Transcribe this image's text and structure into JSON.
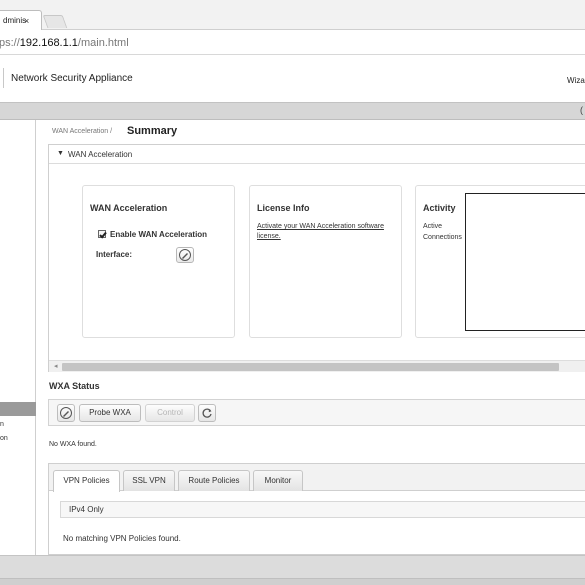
{
  "browser": {
    "tab_title": "dminis",
    "tab_close": "×",
    "url_scheme": "ps://",
    "url_host": "192.168.1.1",
    "url_path": "/main.html"
  },
  "header": {
    "app_title": "Network Security Appliance",
    "wizard_label": "Wiza",
    "right_edge_glyph": "("
  },
  "sidebar": {
    "items": [
      "n",
      "on"
    ]
  },
  "breadcrumb": "WAN Acceleration /",
  "page_title": "Summary",
  "wan_section": {
    "header": "WAN Acceleration",
    "cards": {
      "wan": {
        "title": "WAN Acceleration",
        "enable_label": "Enable WAN Acceleration",
        "enable_checked": true,
        "interface_label": "Interface:"
      },
      "license": {
        "title": "License Info",
        "link": "Activate your WAN Acceleration software license."
      },
      "activity": {
        "title": "Activity",
        "label_line1": "Active",
        "label_line2": "Connections"
      }
    }
  },
  "wxa": {
    "title": "WXA Status",
    "probe_label": "Probe WXA",
    "control_label": "Control",
    "empty_text": "No WXA found."
  },
  "policy_tabs": {
    "tabs": [
      "VPN Policies",
      "SSL VPN",
      "Route Policies",
      "Monitor"
    ],
    "active": "VPN Policies",
    "filter_label": "IPv4 Only",
    "empty_text": "No matching VPN Policies found."
  }
}
